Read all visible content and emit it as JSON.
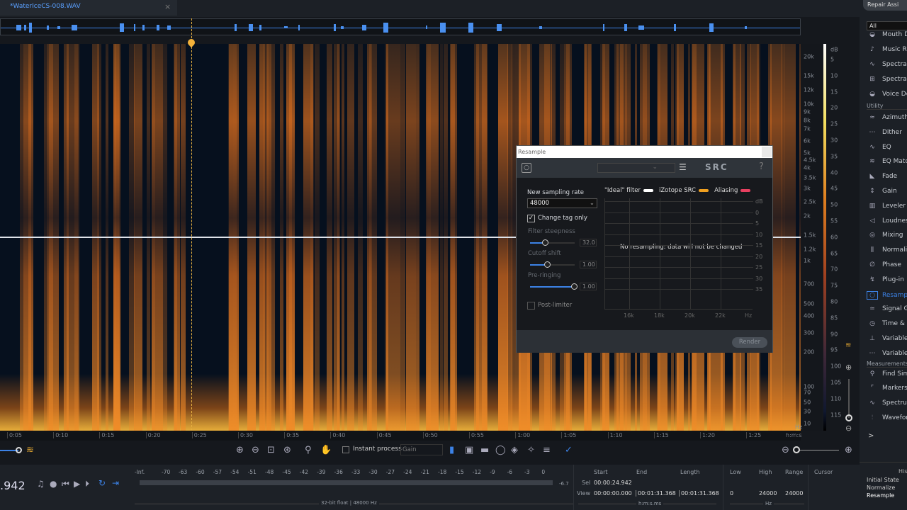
{
  "tab": {
    "title": "*WaterIceCS-008.WAV",
    "close": "×"
  },
  "repair_assistant": "Repair Assi",
  "freq_axis": {
    "labels": [
      "20k",
      "15k",
      "12k",
      "10k",
      "9k",
      "8k",
      "7k",
      "6k",
      "5k",
      "4.5k",
      "4k",
      "3.5k",
      "3k",
      "2.5k",
      "2k",
      "1.5k",
      "1.2k",
      "1k",
      "700",
      "500",
      "400",
      "300",
      "200",
      "100",
      "70",
      "50",
      "30",
      "10"
    ],
    "unit": "Hz"
  },
  "db_axis": {
    "unit": "dB",
    "labels": [
      "5",
      "10",
      "15",
      "20",
      "25",
      "30",
      "35",
      "40",
      "45",
      "50",
      "55",
      "60",
      "65",
      "70",
      "75",
      "80",
      "85",
      "90",
      "95",
      "100",
      "105",
      "110",
      "115"
    ]
  },
  "time_axis": {
    "labels": [
      "0:05",
      "0:10",
      "0:15",
      "0:20",
      "0:25",
      "0:30",
      "0:35",
      "0:40",
      "0:45",
      "0:50",
      "0:55",
      "1:00",
      "1:05",
      "1:10",
      "1:15",
      "1:20",
      "1:25"
    ],
    "unit": "h:m:s"
  },
  "toolbar": {
    "instant_process": "Instant process",
    "instant_checked": false,
    "mode": "Gain"
  },
  "transport": {
    "time": ".942"
  },
  "meter": {
    "scale": [
      "-Inf.",
      "-70",
      "-63",
      "-60",
      "-57",
      "-54",
      "-51",
      "-48",
      "-45",
      "-42",
      "-39",
      "-36",
      "-33",
      "-30",
      "-27",
      "-24",
      "-21",
      "-18",
      "-15",
      "-12",
      "-9",
      "-6",
      "-3",
      "0"
    ],
    "peak": "-6.7",
    "format": "32-bit float | 48000 Hz"
  },
  "selection": {
    "headers": [
      "Start",
      "End",
      "Length"
    ],
    "sel_label": "Sel",
    "sel_start": "00:00:24.942",
    "view_label": "View",
    "view_start": "00:00:00.000",
    "view_end": "00:01:31.368",
    "view_length": "00:01:31.368",
    "unit": "h:m:s.ms"
  },
  "freq_range": {
    "headers": [
      "Low",
      "High",
      "Range"
    ],
    "low": "0",
    "high": "24000",
    "range": "24000",
    "unit": "Hz"
  },
  "cursor_label": "Cursor",
  "sidebar": {
    "filter": "All",
    "items_top": [
      {
        "icon": "mouth-icon",
        "label": "Mouth D"
      },
      {
        "icon": "music-icon",
        "label": "Music R"
      },
      {
        "icon": "spectral-icon",
        "label": "Spectral"
      },
      {
        "icon": "spectral-repair-icon",
        "label": "Spectral"
      },
      {
        "icon": "voice-icon",
        "label": "Voice De"
      }
    ],
    "utility_label": "Utility",
    "utility": [
      {
        "label": "Azimuth"
      },
      {
        "label": "Dither"
      },
      {
        "label": "EQ"
      },
      {
        "label": "EQ Match"
      },
      {
        "label": "Fade"
      },
      {
        "label": "Gain"
      },
      {
        "label": "Leveler"
      },
      {
        "label": "Loudness"
      },
      {
        "label": "Mixing"
      },
      {
        "label": "Normalize"
      },
      {
        "label": "Phase"
      },
      {
        "label": "Plug-in"
      },
      {
        "label": "Resample",
        "active": true
      },
      {
        "label": "Signal G"
      },
      {
        "label": "Time & P"
      },
      {
        "label": "Variable"
      },
      {
        "label": "Variable"
      }
    ],
    "measurements_label": "Measurements",
    "measurements": [
      {
        "label": "Find Sim"
      },
      {
        "label": "Markers"
      },
      {
        "label": "Spectrum"
      },
      {
        "label": "Waveform"
      }
    ],
    "more": ">",
    "history_label": "His",
    "history": [
      "Initial State",
      "Normalize",
      "Resample"
    ]
  },
  "dialog": {
    "title": "Resample",
    "logo": "SRC",
    "help": "?",
    "rate_label": "New sampling rate",
    "rate": "48000",
    "change_tag_only": "Change tag only",
    "change_tag_checked": true,
    "filter_steepness": "Filter steepness",
    "filter_steepness_value": "32.0",
    "filter_steepness_fraction": 0.35,
    "cutoff_shift": "Cutoff shift",
    "cutoff_shift_value": "1.00",
    "cutoff_shift_fraction": 0.4,
    "pre_ringing": "Pre-ringing",
    "pre_ringing_value": "1.00",
    "pre_ringing_fraction": 1.0,
    "post_limiter": "Post-limiter",
    "post_limiter_checked": false,
    "legend": [
      {
        "label": "\"Ideal\" filter",
        "color": "#ffffff"
      },
      {
        "label": "iZotope SRC",
        "color": "#f0a020"
      },
      {
        "label": "Aliasing",
        "color": "#e84060"
      }
    ],
    "graph_message": "No resampling: data will not be changed",
    "graph_y": [
      "dB",
      "0",
      "5",
      "10",
      "15",
      "20",
      "25",
      "30",
      "35"
    ],
    "graph_x": [
      "16k",
      "18k",
      "20k",
      "22k",
      "Hz"
    ],
    "render": "Render"
  }
}
